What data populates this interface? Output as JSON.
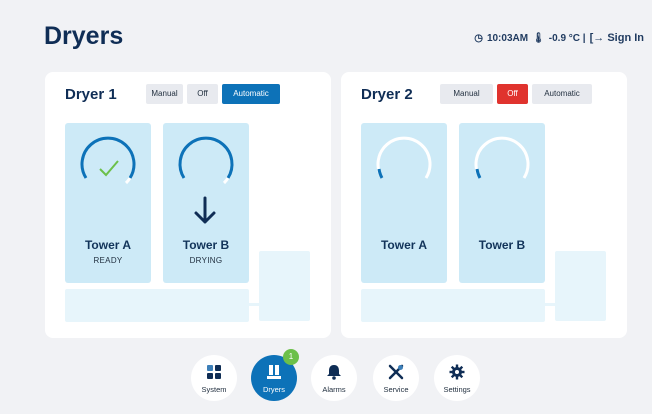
{
  "header": {
    "title": "Dryers",
    "time": "10:03AM",
    "temperature": "-0.9 °C |",
    "sign_in": "Sign In"
  },
  "dryers": [
    {
      "name": "Dryer 1",
      "modes": [
        "Manual",
        "Off",
        "Automatic"
      ],
      "active_mode": "Automatic",
      "towers": [
        {
          "name": "Tower A",
          "status": "READY",
          "icon": "check-icon"
        },
        {
          "name": "Tower B",
          "status": "DRYING",
          "icon": "arrow-down-icon"
        }
      ]
    },
    {
      "name": "Dryer 2",
      "modes": [
        "Manual",
        "Off",
        "Automatic"
      ],
      "active_mode": "Off",
      "towers": [
        {
          "name": "Tower A",
          "status": ""
        },
        {
          "name": "Tower B",
          "status": ""
        }
      ]
    }
  ],
  "nav": {
    "system": "System",
    "dryers": "Dryers",
    "dryers_badge": "1",
    "alarms": "Alarms",
    "service": "Service",
    "settings": "Settings",
    "active": "Dryers"
  },
  "colors": {
    "primary": "#0d72b8",
    "off_active": "#e0332e",
    "ready_check": "#6cc04a",
    "tower_bg": "#cdeaf7"
  }
}
